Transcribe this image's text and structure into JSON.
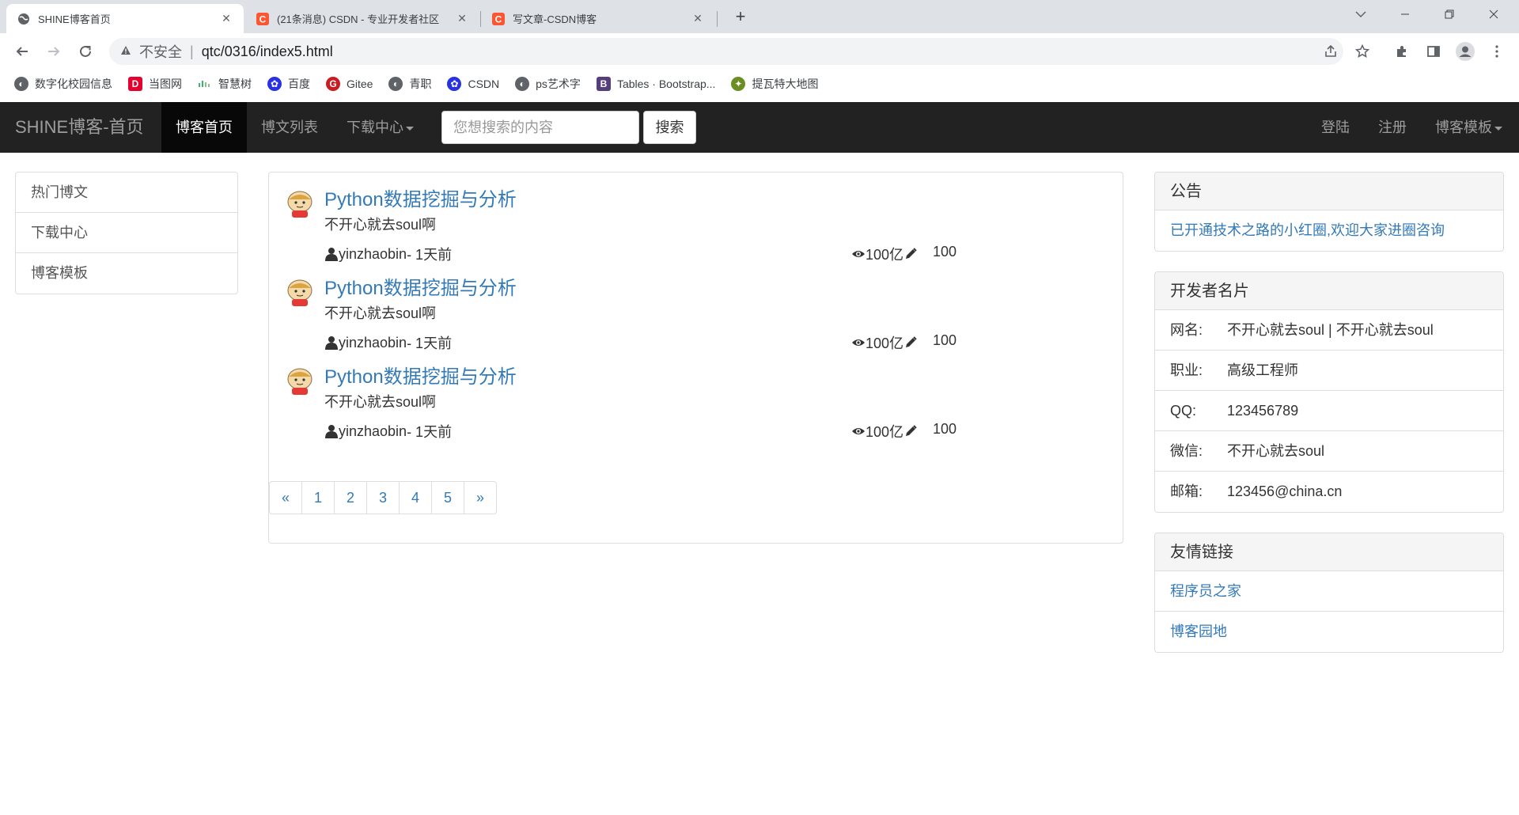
{
  "browser": {
    "tabs": [
      {
        "title": "SHINE博客首页",
        "favicon": "globe-icon"
      },
      {
        "title": "(21条消息) CSDN - 专业开发者社区",
        "favicon": "csdn-icon"
      },
      {
        "title": "写文章-CSDN博客",
        "favicon": "csdn-icon"
      }
    ],
    "close_glyph": "✕",
    "new_tab_glyph": "+",
    "address": {
      "insecure_label": "不安全",
      "url": "qtc/0316/index5.html"
    },
    "bookmarks": [
      {
        "label": "数字化校园信息",
        "icon": "globe-icon"
      },
      {
        "label": "当图网",
        "icon": "td-icon"
      },
      {
        "label": "智慧树",
        "icon": "zhihuishu-icon"
      },
      {
        "label": "百度",
        "icon": "baidu-icon"
      },
      {
        "label": "Gitee",
        "icon": "gitee-icon"
      },
      {
        "label": "青职",
        "icon": "globe-icon"
      },
      {
        "label": "CSDN",
        "icon": "baidu-icon"
      },
      {
        "label": "ps艺术字",
        "icon": "globe-icon"
      },
      {
        "label": "Tables · Bootstrap...",
        "icon": "bootstrap-icon"
      },
      {
        "label": "提瓦特大地图",
        "icon": "genshin-icon"
      }
    ]
  },
  "navbar": {
    "brand": "SHINE博客-首页",
    "items": [
      {
        "label": "博客首页",
        "active": true
      },
      {
        "label": "博文列表",
        "active": false
      },
      {
        "label": "下载中心",
        "active": false,
        "dropdown": true
      }
    ],
    "search_placeholder": "您想搜索的内容",
    "search_button": "搜索",
    "right_items": [
      {
        "label": "登陆"
      },
      {
        "label": "注册"
      },
      {
        "label": "博客模板",
        "dropdown": true
      }
    ]
  },
  "sidebar": {
    "items": [
      {
        "label": "热门博文"
      },
      {
        "label": "下载中心"
      },
      {
        "label": "博客模板"
      }
    ]
  },
  "posts": [
    {
      "title": "Python数据挖掘与分析",
      "summary": "不开心就去soul啊",
      "author": "yinzhaobin",
      "time": "- 1天前",
      "views": "100亿",
      "edits": "100"
    },
    {
      "title": "Python数据挖掘与分析",
      "summary": "不开心就去soul啊",
      "author": "yinzhaobin",
      "time": "- 1天前",
      "views": "100亿",
      "edits": "100"
    },
    {
      "title": "Python数据挖掘与分析",
      "summary": "不开心就去soul啊",
      "author": "yinzhaobin",
      "time": "- 1天前",
      "views": "100亿",
      "edits": "100"
    }
  ],
  "pagination": {
    "prev": "«",
    "pages": [
      "1",
      "2",
      "3",
      "4",
      "5"
    ],
    "next": "»"
  },
  "announcement": {
    "heading": "公告",
    "text": "已开通技术之路的小红圈,欢迎大家进圈咨询"
  },
  "developer_card": {
    "heading": "开发者名片",
    "rows": [
      {
        "key": "网名:",
        "value": "不开心就去soul | 不开心就去soul"
      },
      {
        "key": "职业:",
        "value": "高级工程师"
      },
      {
        "key": "QQ:",
        "value": "123456789"
      },
      {
        "key": "微信:",
        "value": "不开心就去soul"
      },
      {
        "key": "邮箱:",
        "value": "123456@china.cn"
      }
    ]
  },
  "friend_links": {
    "heading": "友情链接",
    "links": [
      {
        "label": "程序员之家"
      },
      {
        "label": "博客园地"
      }
    ]
  },
  "colors": {
    "navbar_bg": "#222222",
    "link": "#337ab7",
    "csdn_red": "#fc5531"
  }
}
